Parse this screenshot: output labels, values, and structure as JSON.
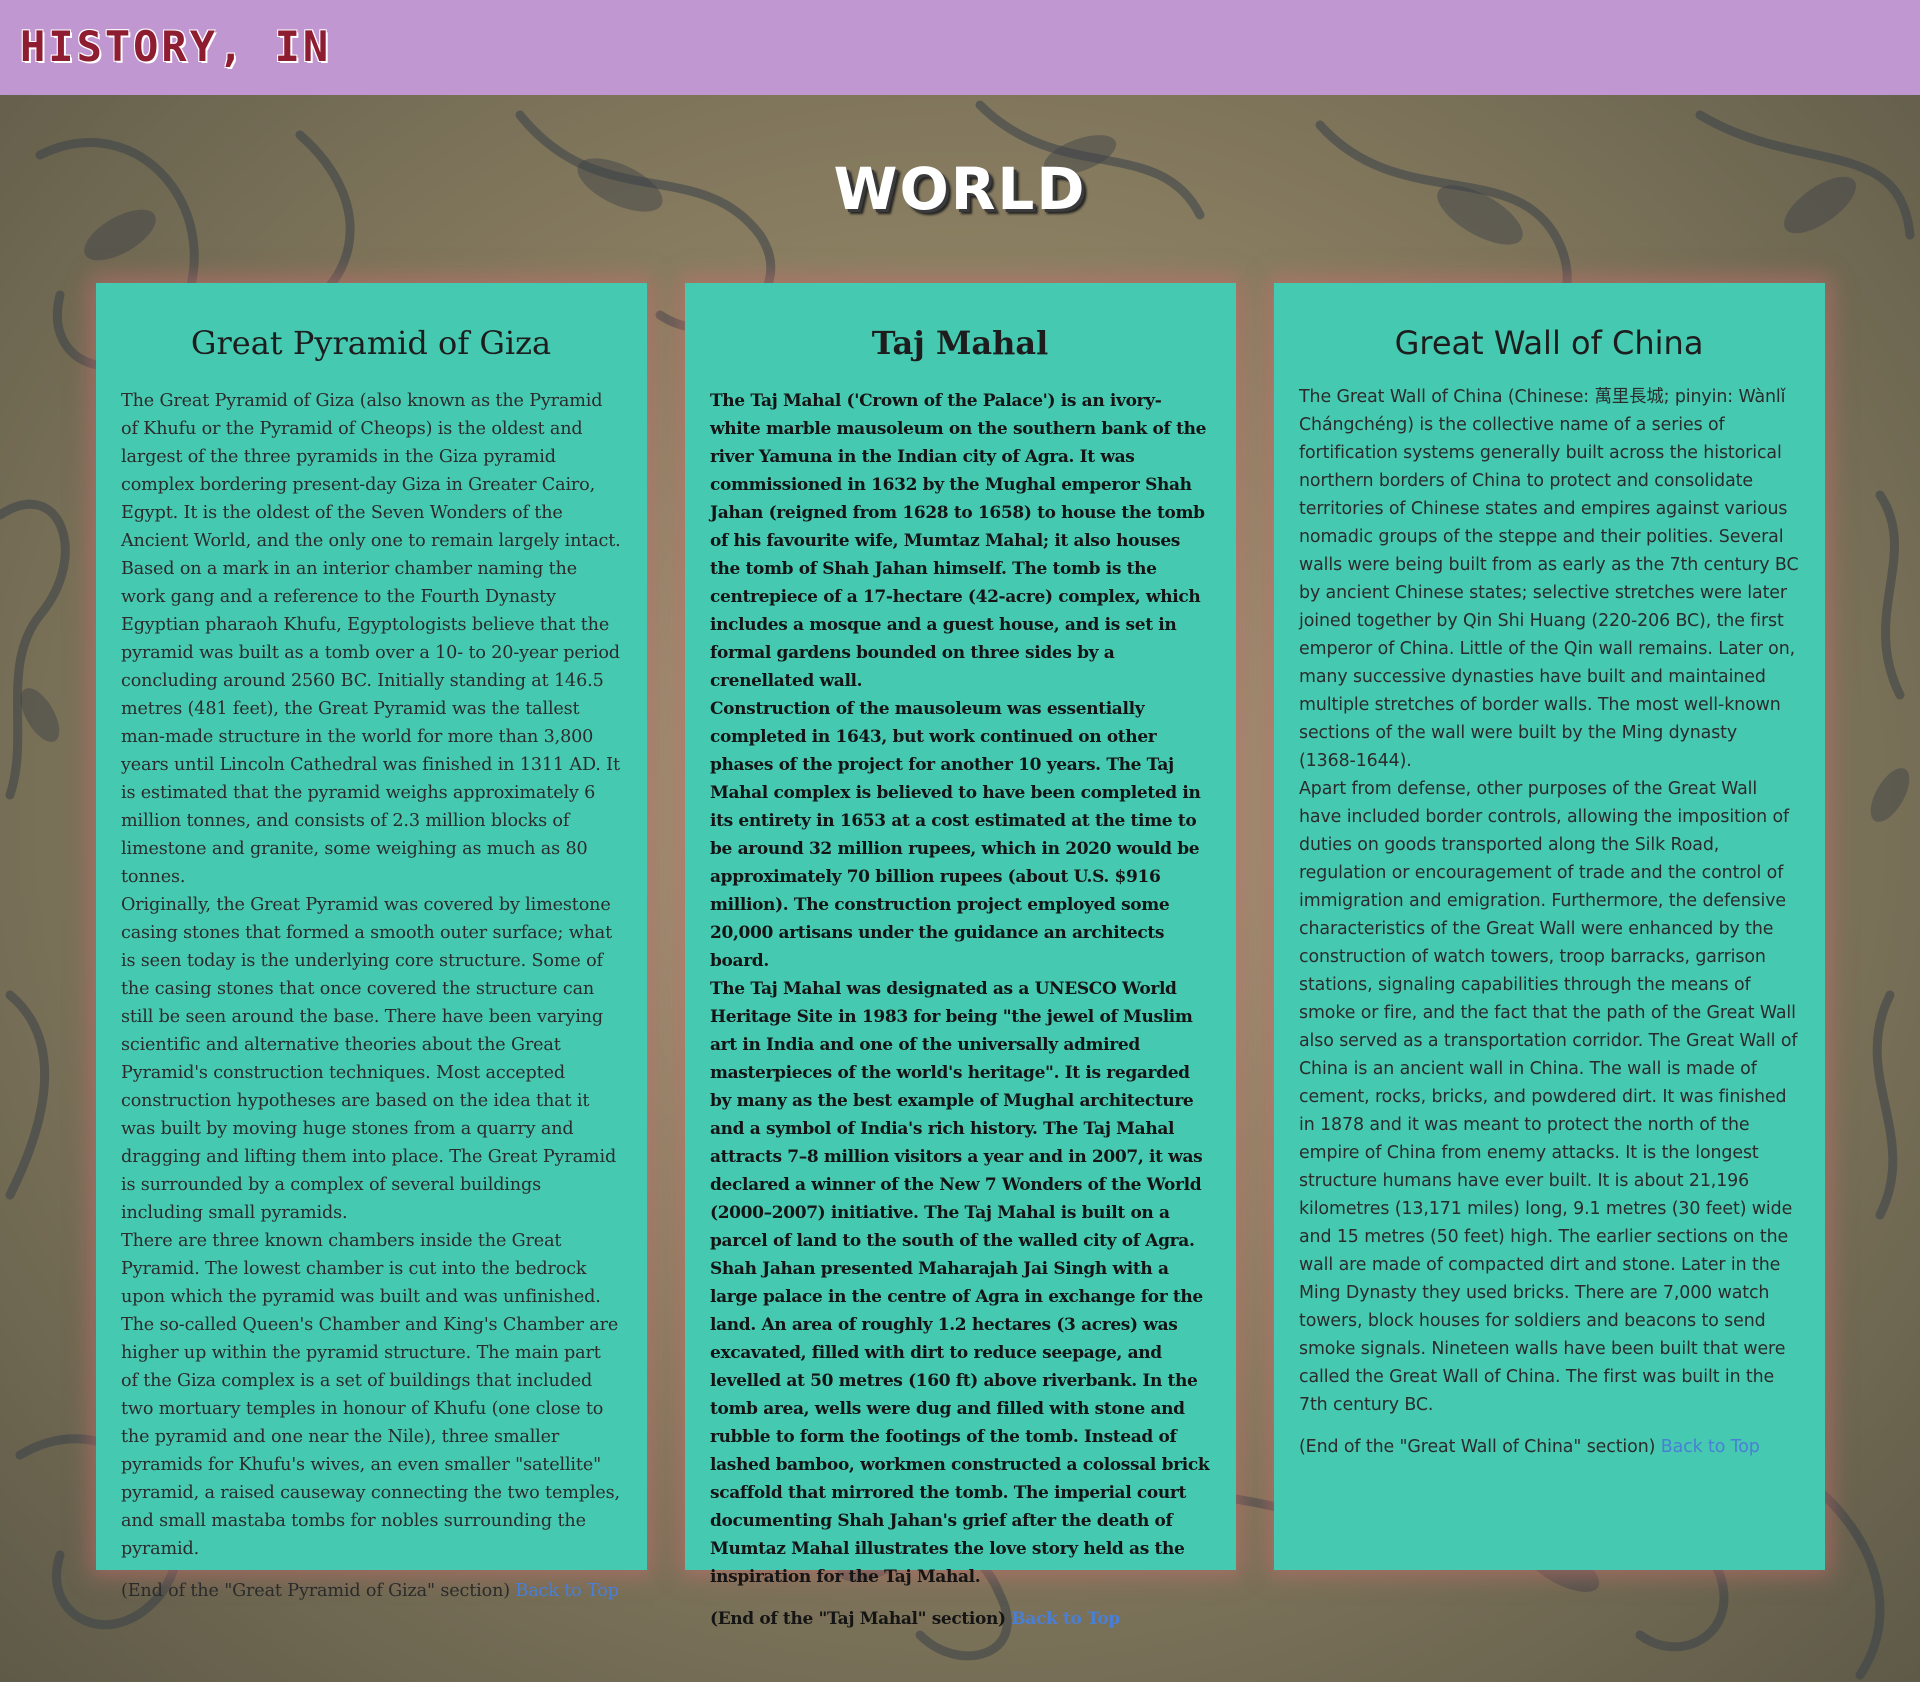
{
  "header": {
    "logo_text": "HISTORY, IN",
    "background_color": "#c197d2"
  },
  "page": {
    "title": "WORLD"
  },
  "cards": [
    {
      "title": "Great Pyramid of Giza",
      "paragraphs": [
        "The Great Pyramid of Giza (also known as the Pyramid of Khufu or the Pyramid of Cheops) is the oldest and largest of the three pyramids in the Giza pyramid complex bordering present-day Giza in Greater Cairo, Egypt. It is the oldest of the Seven Wonders of the Ancient World, and the only one to remain largely intact.",
        "Based on a mark in an interior chamber naming the work gang and a reference to the Fourth Dynasty Egyptian pharaoh Khufu, Egyptologists believe that the pyramid was built as a tomb over a 10- to 20-year period concluding around 2560 BC. Initially standing at 146.5 metres (481 feet), the Great Pyramid was the tallest man-made structure in the world for more than 3,800 years until Lincoln Cathedral was finished in 1311 AD. It is estimated that the pyramid weighs approximately 6 million tonnes, and consists of 2.3 million blocks of limestone and granite, some weighing as much as 80 tonnes.",
        "Originally, the Great Pyramid was covered by limestone casing stones that formed a smooth outer surface; what is seen today is the underlying core structure. Some of the casing stones that once covered the structure can still be seen around the base. There have been varying scientific and alternative theories about the Great Pyramid's construction techniques. Most accepted construction hypotheses are based on the idea that it was built by moving huge stones from a quarry and dragging and lifting them into place. The Great Pyramid is surrounded by a complex of several buildings including small pyramids.",
        "There are three known chambers inside the Great Pyramid. The lowest chamber is cut into the bedrock upon which the pyramid was built and was unfinished. The so-called Queen's Chamber and King's Chamber are higher up within the pyramid structure. The main part of the Giza complex is a set of buildings that included two mortuary temples in honour of Khufu (one close to the pyramid and one near the Nile), three smaller pyramids for Khufu's wives, an even smaller \"satellite\" pyramid, a raised causeway connecting the two temples, and small mastaba tombs for nobles surrounding the pyramid."
      ],
      "end_text": "(End of the \"Great Pyramid of Giza\" section)",
      "back_link": "Back to Top"
    },
    {
      "title": "Taj Mahal",
      "paragraphs": [
        "The Taj Mahal ('Crown of the Palace') is an ivory-white marble mausoleum on the southern bank of the river Yamuna in the Indian city of Agra. It was commissioned in 1632 by the Mughal emperor Shah Jahan (reigned from 1628 to 1658) to house the tomb of his favourite wife, Mumtaz Mahal; it also houses the tomb of Shah Jahan himself. The tomb is the centrepiece of a 17-hectare (42-acre) complex, which includes a mosque and a guest house, and is set in formal gardens bounded on three sides by a crenellated wall.",
        "Construction of the mausoleum was essentially completed in 1643, but work continued on other phases of the project for another 10 years. The Taj Mahal complex is believed to have been completed in its entirety in 1653 at a cost estimated at the time to be around 32 million rupees, which in 2020 would be approximately 70 billion rupees (about U.S. $916 million). The construction project employed some 20,000 artisans under the guidance an architects board.",
        "The Taj Mahal was designated as a UNESCO World Heritage Site in 1983 for being \"the jewel of Muslim art in India and one of the universally admired masterpieces of the world's heritage\". It is regarded by many as the best example of Mughal architecture and a symbol of India's rich history. The Taj Mahal attracts 7–8 million visitors a year and in 2007, it was declared a winner of the New 7 Wonders of the World (2000–2007) initiative. The Taj Mahal is built on a parcel of land to the south of the walled city of Agra. Shah Jahan presented Maharajah Jai Singh with a large palace in the centre of Agra in exchange for the land. An area of roughly 1.2 hectares (3 acres) was excavated, filled with dirt to reduce seepage, and levelled at 50 metres (160 ft) above riverbank. In the tomb area, wells were dug and filled with stone and rubble to form the footings of the tomb. Instead of lashed bamboo, workmen constructed a colossal brick scaffold that mirrored the tomb. The imperial court documenting Shah Jahan's grief after the death of Mumtaz Mahal illustrates the love story held as the inspiration for the Taj Mahal."
      ],
      "end_text": "(End of the \"Taj Mahal\" section)",
      "back_link": "Back to Top"
    },
    {
      "title": "Great Wall of China",
      "paragraphs": [
        "The Great Wall of China (Chinese: 萬里長城; pinyin: Wànlǐ Chángchéng) is the collective name of a series of fortification systems generally built across the historical northern borders of China to protect and consolidate territories of Chinese states and empires against various nomadic groups of the steppe and their polities. Several walls were being built from as early as the 7th century BC by ancient Chinese states; selective stretches were later joined together by Qin Shi Huang (220-206 BC), the first emperor of China. Little of the Qin wall remains. Later on, many successive dynasties have built and maintained multiple stretches of border walls. The most well-known sections of the wall were built by the Ming dynasty (1368-1644).",
        "Apart from defense, other purposes of the Great Wall have included border controls, allowing the imposition of duties on goods transported along the Silk Road, regulation or encouragement of trade and the control of immigration and emigration. Furthermore, the defensive characteristics of the Great Wall were enhanced by the construction of watch towers, troop barracks, garrison stations, signaling capabilities through the means of smoke or fire, and the fact that the path of the Great Wall also served as a transportation corridor. The Great Wall of China is an ancient wall in China. The wall is made of cement, rocks, bricks, and powdered dirt. It was finished in 1878 and it was meant to protect the north of the empire of China from enemy attacks. It is the longest structure humans have ever built. It is about 21,196 kilometres (13,171 miles) long, 9.1 metres (30 feet) wide and 15 metres (50 feet) high. The earlier sections on the wall are made of compacted dirt and stone. Later in the Ming Dynasty they used bricks. There are 7,000 watch towers, block houses for soldiers and beacons to send smoke signals. Nineteen walls have been built that were called the Great Wall of China. The first was built in the 7th century BC."
      ],
      "end_text": "(End of the \"Great Wall of China\" section)",
      "back_link": "Back to Top"
    }
  ],
  "colors": {
    "card_background": "#46c9b1",
    "link": "#4a7fd6",
    "logo_text": "#8f1d31"
  }
}
